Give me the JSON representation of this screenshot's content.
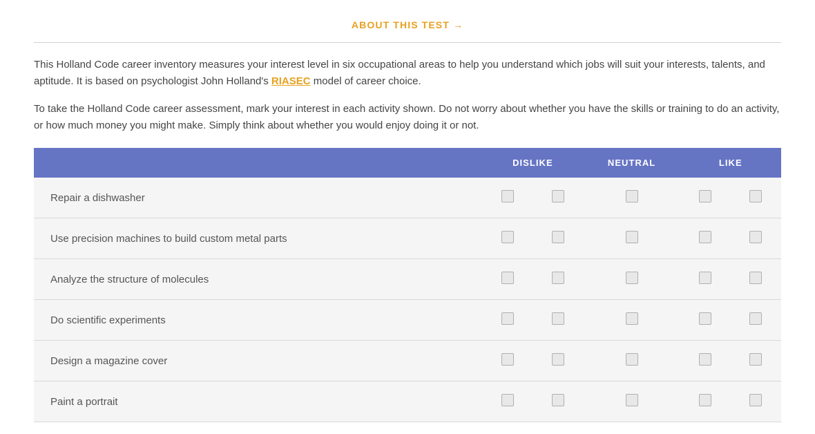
{
  "header": {
    "about_link": "ABOUT THIS TEST",
    "arrow": "→"
  },
  "description": {
    "text1": "This Holland Code career inventory measures your interest level in six occupational areas to help you understand which jobs will suit your interests, talents, and aptitude. It is based on psychologist John Holland's ",
    "riasec_text": "RIASEC",
    "text2": " model of career choice."
  },
  "instructions": {
    "text": "To take the Holland Code career assessment, mark your interest in each activity shown. Do not worry about whether you have the skills or training to do an activity, or how much money you might make. Simply think about whether you would enjoy doing it or not."
  },
  "table": {
    "columns": {
      "activity": "",
      "dislike": "DISLIKE",
      "neutral": "NEUTRAL",
      "like": "LIKE"
    },
    "rows": [
      {
        "id": 1,
        "label": "Repair a dishwasher"
      },
      {
        "id": 2,
        "label": "Use precision machines to build custom metal parts"
      },
      {
        "id": 3,
        "label": "Analyze the structure of molecules"
      },
      {
        "id": 4,
        "label": "Do scientific experiments"
      },
      {
        "id": 5,
        "label": "Design a magazine cover"
      },
      {
        "id": 6,
        "label": "Paint a portrait"
      }
    ]
  },
  "colors": {
    "header_bg": "#6674c4",
    "accent_orange": "#e8a020",
    "row_bg": "#f5f5f5",
    "border": "#d8d8d8",
    "checkbox_bg": "#e8e8e8",
    "checkbox_border": "#b0b0b0"
  }
}
